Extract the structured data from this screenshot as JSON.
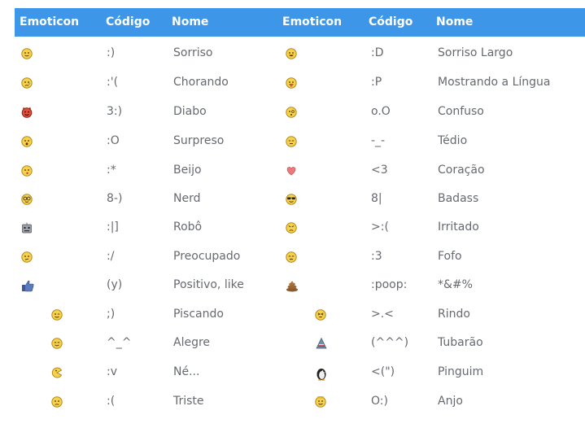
{
  "header": {
    "emoticon": "Emoticon",
    "codigo": "Código",
    "nome": "Nome"
  },
  "colors": {
    "header_bg": "#3d96e8",
    "header_text": "#ffffff",
    "body_text": "#666a70"
  },
  "rows": [
    {
      "left": {
        "icon": "smile-icon",
        "code": ":)",
        "name": "Sorriso"
      },
      "right": {
        "icon": "big-smile-icon",
        "code": ":D",
        "name": "Sorriso Largo"
      }
    },
    {
      "left": {
        "icon": "crying-icon",
        "code": ":'(",
        "name": "Chorando"
      },
      "right": {
        "icon": "tongue-icon",
        "code": ":P",
        "name": "Mostrando a Língua"
      }
    },
    {
      "left": {
        "icon": "devil-icon",
        "code": "3:)",
        "name": "Diabo"
      },
      "right": {
        "icon": "confused-icon",
        "code": "o.O",
        "name": "Confuso"
      }
    },
    {
      "left": {
        "icon": "surprised-icon",
        "code": ":O",
        "name": "Surpreso"
      },
      "right": {
        "icon": "bored-icon",
        "code": "-_-",
        "name": "Tédio"
      }
    },
    {
      "left": {
        "icon": "kiss-icon",
        "code": ":*",
        "name": "Beijo"
      },
      "right": {
        "icon": "heart-icon",
        "code": "<3",
        "name": "Coração"
      }
    },
    {
      "left": {
        "icon": "nerd-icon",
        "code": "8-)",
        "name": "Nerd"
      },
      "right": {
        "icon": "sunglasses-icon",
        "code": "8|",
        "name": "Badass"
      }
    },
    {
      "left": {
        "icon": "robot-icon",
        "code": ":|]",
        "name": "Robô"
      },
      "right": {
        "icon": "angry-icon",
        "code": ">:(",
        "name": "Irritado"
      }
    },
    {
      "left": {
        "icon": "worried-icon",
        "code": ":/",
        "name": "Preocupado"
      },
      "right": {
        "icon": "cute-icon",
        "code": ":3",
        "name": "Fofo"
      }
    },
    {
      "left": {
        "icon": "thumbs-up-icon",
        "code": "(y)",
        "name": "Positivo, like"
      },
      "right": {
        "icon": "poop-icon",
        "code": ":poop:",
        "name": "*&#%"
      }
    },
    {
      "left": {
        "icon": "wink-icon",
        "code": ";)",
        "name": "Piscando"
      },
      "right": {
        "icon": "laughing-icon",
        "code": ">.<",
        "name": "Rindo"
      }
    },
    {
      "left": {
        "icon": "happy-icon",
        "code": "^_^",
        "name": "Alegre"
      },
      "right": {
        "icon": "shark-icon",
        "code": "(^^^)",
        "name": "Tubarão"
      }
    },
    {
      "left": {
        "icon": "pacman-icon",
        "code": ":v",
        "name": "Né..."
      },
      "right": {
        "icon": "penguin-icon",
        "code": "<(\")",
        "name": "Pinguim"
      }
    },
    {
      "left": {
        "icon": "sad-icon",
        "code": ":(",
        "name": "Triste"
      },
      "right": {
        "icon": "angel-icon",
        "code": "O:)",
        "name": "Anjo"
      }
    }
  ]
}
